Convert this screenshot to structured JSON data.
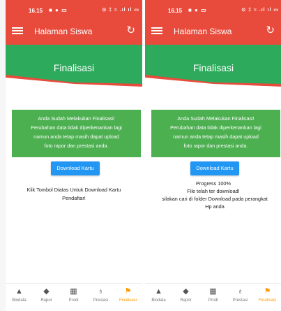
{
  "status_bar": {
    "time": "16.15",
    "left_icons": "■ ● ▭",
    "right_icons": "⊙ ‡ ≈ .ıl ıl ▭"
  },
  "app_bar": {
    "title": "Halaman Siswa",
    "menu_icon": "hamburger-icon",
    "refresh_icon": "refresh-icon",
    "refresh_glyph": "↻"
  },
  "banner": {
    "title": "Finalisasi",
    "color": "#2eaa5c",
    "stripe_color": "#e84b3c"
  },
  "card": {
    "line1": "Anda Sudah Melakukan Finalisasi!",
    "line2": "Perubahan data tidak diperkenankan lagi",
    "line3": "namun anda tetap masih dapat upload",
    "line4": "foto rapor dan prestasi anda.",
    "color": "#4caf50"
  },
  "download_button": {
    "label": "Download Kartu",
    "color": "#2196f3"
  },
  "left_screen": {
    "hint_line1": "Klik Tombol Diatas Untuk Download Kartu",
    "hint_line2": "Pendaftar!"
  },
  "right_screen": {
    "progress": "Progress 100%",
    "done": "File telah ter download!",
    "folder_line1": "silakan cari di folder Download pada perangkat",
    "folder_line2": "Hp anda"
  },
  "bottom_nav": {
    "items": [
      {
        "label": "Biodata",
        "icon": "person-icon",
        "glyph": "▲"
      },
      {
        "label": "Rapor",
        "icon": "graduation-cap-icon",
        "glyph": "◆"
      },
      {
        "label": "Prodi",
        "icon": "building-icon",
        "glyph": "▦"
      },
      {
        "label": "Prestasi",
        "icon": "medal-icon",
        "glyph": "♁"
      },
      {
        "label": "Finalisasi",
        "icon": "flag-icon",
        "glyph": "⚑"
      }
    ],
    "active_index": 4,
    "active_color": "#ff9800"
  }
}
